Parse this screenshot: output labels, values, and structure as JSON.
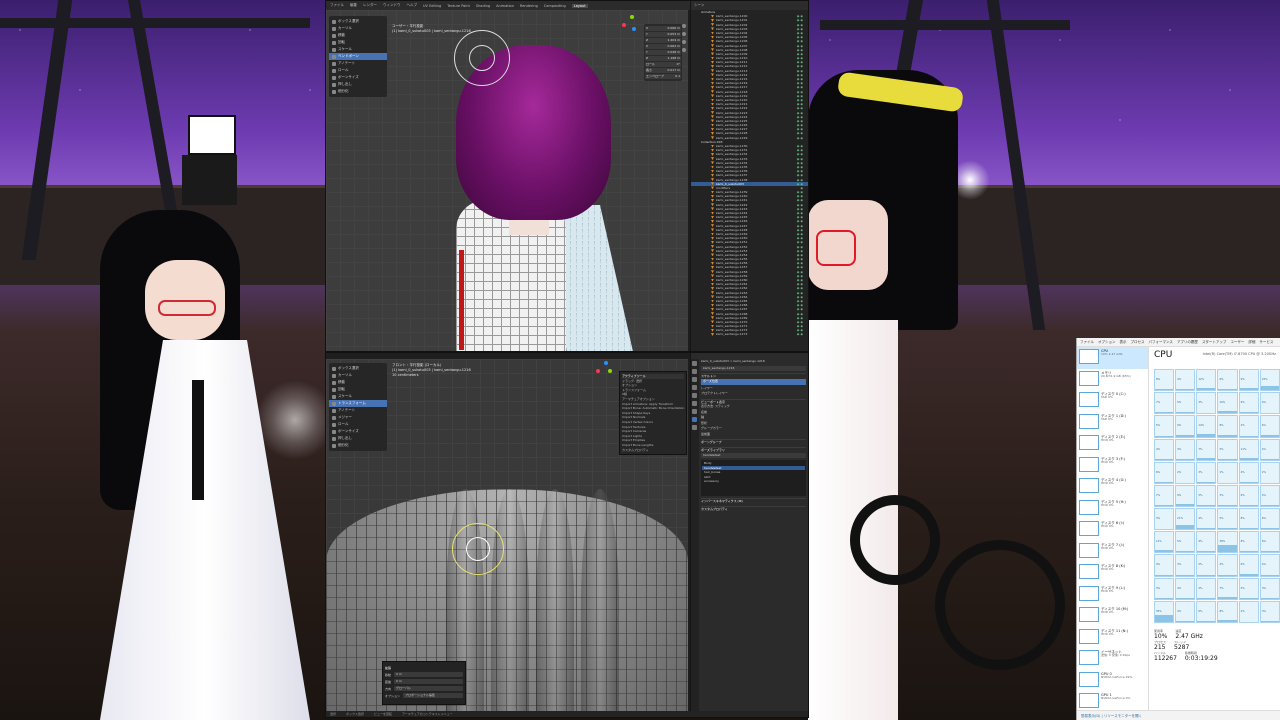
{
  "blender_top": {
    "menu": [
      "ファイル",
      "編集",
      "レンダー",
      "ウィンドウ",
      "ヘルプ",
      "UV Editing",
      "Texture Paint",
      "Shading",
      "Animation",
      "Rendering",
      "Compositing",
      "Layout"
    ],
    "active_workspace": "Layout",
    "viewport_title_1": "ユーザー・平行投影",
    "viewport_title_2": "(1) kami_0_sukotu003 | kami_sentangu.1216",
    "tools": [
      "ボックス選択",
      "カーソル",
      "移動",
      "回転",
      "スケール",
      "ベンドボーン",
      "アノテート",
      "ロール",
      "ボーンサイズ",
      "押し出し",
      "細分化"
    ],
    "selected_tool_index": 5,
    "npanel_rows": [
      {
        "k": "X",
        "v": "0.066 m"
      },
      {
        "k": "Y",
        "v": "0.053 m"
      },
      {
        "k": "Z",
        "v": "1.204 m"
      },
      {
        "k": "X",
        "v": "0.062 m"
      },
      {
        "k": "Y",
        "v": "0.048 m"
      },
      {
        "k": "Z",
        "v": "1.198 m"
      },
      {
        "k": "ロール",
        "v": "0°"
      },
      {
        "k": "長さ",
        "v": "0.017 m"
      },
      {
        "k": "エンベロープ",
        "v": "0.1"
      }
    ],
    "outliner_header": "シーン",
    "outliner_rows": [
      {
        "name": "Armature",
        "type": "coll",
        "vis": ""
      },
      {
        "name": "kami_sentangu.1200",
        "type": "bone",
        "vis": "◉◉"
      },
      {
        "name": "kami_sentangu.1201",
        "type": "bone",
        "vis": "◉◉"
      },
      {
        "name": "kami_sentangu.1202",
        "type": "bone",
        "vis": "◉◉"
      },
      {
        "name": "kami_sentangu.1203",
        "type": "bone",
        "vis": "◉◉"
      },
      {
        "name": "kami_sentangu.1204",
        "type": "bone",
        "vis": "◉◉"
      },
      {
        "name": "kami_sentangu.1205",
        "type": "bone",
        "vis": "◉◉"
      },
      {
        "name": "kami_sentangu.1206",
        "type": "bone",
        "vis": "◉◉"
      },
      {
        "name": "kami_sentangu.1207",
        "type": "bone",
        "vis": "◉◉"
      },
      {
        "name": "kami_sentangu.1208",
        "type": "bone",
        "vis": "◉◉"
      },
      {
        "name": "kami_sentangu.1209",
        "type": "bone",
        "vis": "◉◉"
      },
      {
        "name": "kami_sentangu.1210",
        "type": "bone",
        "vis": "◉◉"
      },
      {
        "name": "kami_sentangu.1211",
        "type": "bone",
        "vis": "◉◉"
      },
      {
        "name": "kami_sentangu.1212",
        "type": "bone",
        "vis": "◉◉"
      },
      {
        "name": "kami_sentangu.1213",
        "type": "bone",
        "vis": "◉◉"
      },
      {
        "name": "kami_sentangu.1214",
        "type": "bone",
        "vis": "◉◉"
      },
      {
        "name": "kami_sentangu.1215",
        "type": "bone",
        "vis": "◉◉"
      },
      {
        "name": "kami_sentangu.1216",
        "type": "bone",
        "vis": "◉◉"
      },
      {
        "name": "kami_sentangu.1217",
        "type": "bone",
        "vis": "◉◉"
      },
      {
        "name": "kami_sentangu.1218",
        "type": "bone",
        "vis": "◉◉"
      },
      {
        "name": "kami_sentangu.1219",
        "type": "bone",
        "vis": "◉◉"
      },
      {
        "name": "kami_sentangu.1220",
        "type": "bone",
        "vis": "◉◉"
      },
      {
        "name": "kami_sentangu.1221",
        "type": "bone",
        "vis": "◉◉"
      },
      {
        "name": "kami_sentangu.1222",
        "type": "bone",
        "vis": "◉◉"
      },
      {
        "name": "kami_sentangu.1223",
        "type": "bone",
        "vis": "◉◉"
      },
      {
        "name": "kami_sentangu.1224",
        "type": "bone",
        "vis": "◉◉"
      },
      {
        "name": "kami_sentangu.1225",
        "type": "bone",
        "vis": "◉◉"
      },
      {
        "name": "kami_sentangu.1226",
        "type": "bone",
        "vis": "◉◉"
      },
      {
        "name": "kami_sentangu.1227",
        "type": "bone",
        "vis": "◉◉"
      },
      {
        "name": "kami_sentangu.1228",
        "type": "bone",
        "vis": "◉◉"
      },
      {
        "name": "kami_sentangu.1229",
        "type": "bone",
        "vis": "◉◉"
      },
      {
        "name": "Collection.003",
        "type": "coll",
        "vis": ""
      },
      {
        "name": "kami_sentangu.1230",
        "type": "bone",
        "vis": "◉◉"
      },
      {
        "name": "kami_sentangu.1231",
        "type": "bone",
        "vis": "◉◉"
      },
      {
        "name": "kami_sentangu.1232",
        "type": "bone",
        "vis": "◉◉"
      },
      {
        "name": "kami_sentangu.1233",
        "type": "bone",
        "vis": "◉◉"
      },
      {
        "name": "kami_sentangu.1234",
        "type": "bone",
        "vis": "◉◉"
      },
      {
        "name": "kami_sentangu.1235",
        "type": "bone",
        "vis": "◉◉"
      },
      {
        "name": "kami_sentangu.1236",
        "type": "bone",
        "vis": "◉◉"
      },
      {
        "name": "kami_sentangu.1237",
        "type": "bone",
        "vis": "◉◉"
      },
      {
        "name": "kami_sentangu.1238",
        "type": "bone",
        "vis": "◉◉"
      },
      {
        "name": "kami_0_sukotu003",
        "type": "sel",
        "vis": "◉◉"
      },
      {
        "name": "modifiers",
        "type": "bone",
        "vis": "◉"
      },
      {
        "name": "kami_sentangu.1239",
        "type": "bone",
        "vis": "◉◉"
      },
      {
        "name": "kami_sentangu.1240",
        "type": "bone",
        "vis": "◉◉"
      },
      {
        "name": "kami_sentangu.1241",
        "type": "bone",
        "vis": "◉◉"
      },
      {
        "name": "kami_sentangu.1242",
        "type": "bone",
        "vis": "◉◉"
      },
      {
        "name": "kami_sentangu.1243",
        "type": "bone",
        "vis": "◉◉"
      },
      {
        "name": "kami_sentangu.1244",
        "type": "bone",
        "vis": "◉◉"
      },
      {
        "name": "kami_sentangu.1245",
        "type": "bone",
        "vis": "◉◉"
      },
      {
        "name": "kami_sentangu.1246",
        "type": "bone",
        "vis": "◉◉"
      },
      {
        "name": "kami_sentangu.1247",
        "type": "bone",
        "vis": "◉◉"
      },
      {
        "name": "kami_sentangu.1248",
        "type": "bone",
        "vis": "◉◉"
      },
      {
        "name": "kami_sentangu.1249",
        "type": "bone",
        "vis": "◉◉"
      },
      {
        "name": "kami_sentangu.1250",
        "type": "bone",
        "vis": "◉◉"
      },
      {
        "name": "kami_sentangu.1251",
        "type": "bone",
        "vis": "◉◉"
      },
      {
        "name": "kami_sentangu.1252",
        "type": "bone",
        "vis": "◉◉"
      },
      {
        "name": "kami_sentangu.1253",
        "type": "bone",
        "vis": "◉◉"
      },
      {
        "name": "kami_sentangu.1254",
        "type": "bone",
        "vis": "◉◉"
      },
      {
        "name": "kami_sentangu.1255",
        "type": "bone",
        "vis": "◉◉"
      },
      {
        "name": "kami_sentangu.1256",
        "type": "bone",
        "vis": "◉◉"
      },
      {
        "name": "kami_sentangu.1257",
        "type": "bone",
        "vis": "◉◉"
      },
      {
        "name": "kami_sentangu.1258",
        "type": "bone",
        "vis": "◉◉"
      },
      {
        "name": "kami_sentangu.1259",
        "type": "bone",
        "vis": "◉◉"
      },
      {
        "name": "kami_sentangu.1260",
        "type": "bone",
        "vis": "◉◉"
      },
      {
        "name": "kami_sentangu.1261",
        "type": "bone",
        "vis": "◉◉"
      },
      {
        "name": "kami_sentangu.1262",
        "type": "bone",
        "vis": "◉◉"
      },
      {
        "name": "kami_sentangu.1263",
        "type": "bone",
        "vis": "◉◉"
      },
      {
        "name": "kami_sentangu.1264",
        "type": "bone",
        "vis": "◉◉"
      },
      {
        "name": "kami_sentangu.1265",
        "type": "bone",
        "vis": "◉◉"
      },
      {
        "name": "kami_sentangu.1266",
        "type": "bone",
        "vis": "◉◉"
      },
      {
        "name": "kami_sentangu.1267",
        "type": "bone",
        "vis": "◉◉"
      },
      {
        "name": "kami_sentangu.1268",
        "type": "bone",
        "vis": "◉◉"
      },
      {
        "name": "kami_sentangu.1269",
        "type": "bone",
        "vis": "◉◉"
      },
      {
        "name": "kami_sentangu.1270",
        "type": "bone",
        "vis": "◉◉"
      },
      {
        "name": "kami_sentangu.1271",
        "type": "bone",
        "vis": "◉◉"
      },
      {
        "name": "kami_sentangu.1272",
        "type": "bone",
        "vis": "◉◉"
      },
      {
        "name": "kami_sentangu.1273",
        "type": "bone",
        "vis": "◉◉"
      }
    ]
  },
  "blender_bottom": {
    "viewport_title_1": "フロント・平行投影 (ローカル)",
    "viewport_title_2": "(1) kami_0_sukotu003 | kami_sentangu.1216",
    "viewport_title_3": "10 centimeters",
    "tools": [
      "ボックス選択",
      "カーソル",
      "移動",
      "回転",
      "スケール",
      "トランスフォーム",
      "アノテート",
      "メジャー",
      "ロール",
      "ボーンサイズ",
      "押し出し",
      "細分化"
    ],
    "selected_tool_index": 5,
    "popover_rows": [
      "アクティブツール",
      "ドラッグ: 選択",
      "オプション",
      "トランスフォーム",
      "X線",
      "アーマチュアオプション",
      "Import Armature: Apply Transform",
      "Import Bone: Automatic Bone Orientation",
      "Import Shape Keys",
      "Import Normals",
      "Import Vertex Colors",
      "Import Textures",
      "Import Cameras",
      "Import Lights",
      "Import Empties",
      "Import Bone Lengths",
      "カスタムプロパティ"
    ],
    "redo_title": "拡張",
    "redo_rows": [
      {
        "label": "移動",
        "value": "0 m"
      },
      {
        "label": "距離",
        "value": "0 m"
      },
      {
        "label": "方向",
        "value": "グローバル"
      },
      {
        "label": "オプション",
        "value": "プロポーショナル編集"
      }
    ],
    "props_lines": [
      {
        "t": "kami_0_sukotu003 > kami_sentangu.1216",
        "c": ""
      },
      {
        "t": "kami_sentangu.1216",
        "c": "box"
      },
      {
        "t": "スケルトン",
        "c": "sec"
      },
      {
        "t": "ポーズ位置",
        "c": "blue"
      },
      {
        "t": "レイヤー",
        "c": ""
      },
      {
        "t": "プロテクトレイヤー",
        "c": ""
      },
      {
        "t": "ビューポート表示",
        "c": "sec"
      },
      {
        "t": "表示方法: スティック",
        "c": ""
      },
      {
        "t": "名前",
        "c": ""
      },
      {
        "t": "軸",
        "c": ""
      },
      {
        "t": "形状",
        "c": ""
      },
      {
        "t": "グループカラー",
        "c": ""
      },
      {
        "t": "最前面",
        "c": ""
      },
      {
        "t": "ボーングループ",
        "c": "sec"
      },
      {
        "t": "ポーズライブラリ",
        "c": "sec"
      },
      {
        "t": "hands&feet",
        "c": "box"
      }
    ],
    "props_list": [
      "Body",
      "hands&feet",
      "hair_bones",
      "skirt",
      "accessory"
    ],
    "props_list_selected": 1,
    "props_tail": [
      "インバースキネマティクス (IK)",
      "カスタムプロパティ"
    ],
    "status": [
      "選択",
      "ボックス選択",
      "ビューを回転",
      "アーマチュアのコンテキストメニュー"
    ]
  },
  "taskmgr": {
    "menu": [
      "ファイル",
      "オプション",
      "表示",
      "プロセス",
      "パフォーマンス",
      "アプリの履歴",
      "スタートアップ",
      "ユーザー",
      "詳細",
      "サービス"
    ],
    "left_items": [
      {
        "t": "CPU",
        "s": "10% 2.47 GHz"
      },
      {
        "t": "メモリ",
        "s": "20.8/31.9 GB (65%)"
      },
      {
        "t": "ディスク 0 (C:)",
        "s": "SSD 0%"
      },
      {
        "t": "ディスク 1 (D:)",
        "s": "SSD 0%"
      },
      {
        "t": "ディスク 2 (E:)",
        "s": "HDD 0%"
      },
      {
        "t": "ディスク 3 (F:)",
        "s": "HDD 0%"
      },
      {
        "t": "ディスク 4 (G:)",
        "s": "HDD 0%"
      },
      {
        "t": "ディスク 5 (H:)",
        "s": "HDD 0%"
      },
      {
        "t": "ディスク 6 (I:)",
        "s": "HDD 0%"
      },
      {
        "t": "ディスク 7 (J:)",
        "s": "HDD 0%"
      },
      {
        "t": "ディスク 8 (K:)",
        "s": "HDD 0%"
      },
      {
        "t": "ディスク 9 (L:)",
        "s": "HDD 0%"
      },
      {
        "t": "ディスク 10 (M:)",
        "s": "HDD 0%"
      },
      {
        "t": "ディスク 11 (N:)",
        "s": "HDD 0%"
      },
      {
        "t": "イーサネット",
        "s": "送信: 0 受信: 0 Kbps"
      },
      {
        "t": "GPU 0",
        "s": "NVIDIA GeForce 29%"
      },
      {
        "t": "GPU 1",
        "s": "NVIDIA GeForce 0%"
      }
    ],
    "title": "CPU",
    "model": "Intel(R) Core(TM) i7-8700 CPU @ 3.20GHz",
    "core_values": [
      8,
      4,
      12,
      6,
      9,
      22,
      7,
      5,
      3,
      10,
      6,
      4,
      5,
      9,
      14,
      8,
      2,
      6,
      4,
      3,
      7,
      5,
      11,
      4,
      6,
      2,
      3,
      1,
      4,
      2,
      7,
      9,
      5,
      3,
      6,
      4,
      3,
      21,
      4,
      5,
      8,
      6,
      12,
      5,
      9,
      38,
      8,
      6,
      4,
      3,
      5,
      2,
      6,
      4,
      3,
      4,
      2,
      7,
      5,
      3,
      35,
      4,
      6,
      8,
      2,
      3
    ],
    "core_labels_pct": "%",
    "stats": [
      {
        "label": "使用率",
        "value": "10%"
      },
      {
        "label": "速度",
        "value": "2.47 GHz"
      },
      {
        "label": "プロセス",
        "value": "215"
      },
      {
        "label": "スレッド",
        "value": "5287"
      },
      {
        "label": "ハンドル",
        "value": "112267"
      },
      {
        "label": "稼働時間",
        "value": "0:03:19:29"
      }
    ],
    "footer": "簡易表示(D) | リソースモニターを開く"
  }
}
